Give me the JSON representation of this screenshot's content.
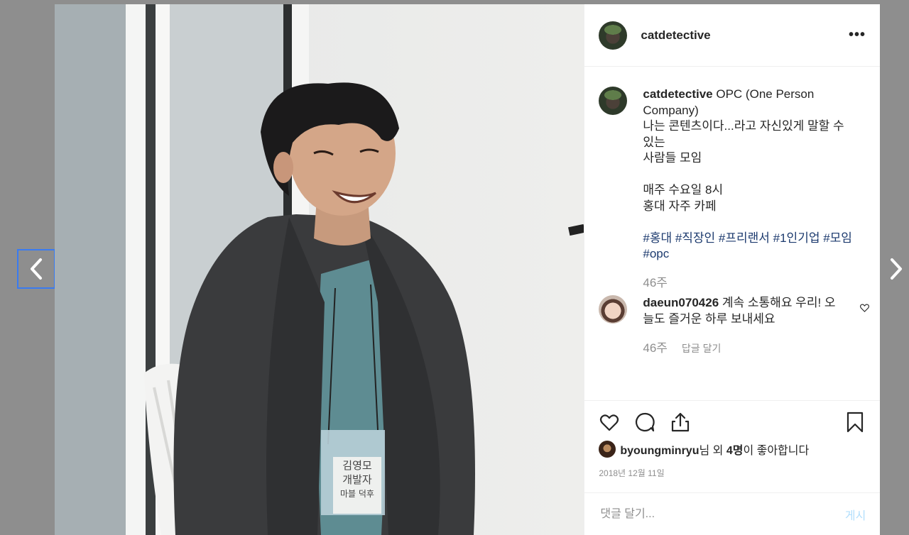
{
  "post": {
    "username": "catdetective",
    "more_icon": "more-horizontal-icon",
    "caption_lines": [
      "OPC (One Person",
      "Company)",
      "나는 콘텐츠이다...라고 자신있게 말할 수 있는",
      "사람들 모임",
      "",
      "매주 수요일 8시",
      "홍대 자주 카페",
      ""
    ],
    "hashtags_line1": "#홍대 #직장인 #프리랜서 #1인기업 #모임",
    "hashtags_line2": "#opc",
    "caption_time": "46주",
    "photo_nametag": [
      "김영모",
      "개발자",
      "마블 덕후"
    ]
  },
  "comments": [
    {
      "username": "daeun070426",
      "text_line1": "계속 소통해요 우리! 오",
      "text_line2": "늘도 즐거운 하루 보내세요",
      "time": "46주",
      "reply_label": "답글 달기"
    }
  ],
  "likes": {
    "user": "byoungminryu",
    "suffix_nim": "님 외 ",
    "count": "4명",
    "suffix_end": "이 좋아합니다"
  },
  "date": "2018년 12월 11일",
  "comment_input": {
    "placeholder": "댓글 달기...",
    "value": ""
  },
  "post_button": "게시",
  "colors": {
    "hashtag": "#1c3a6e",
    "post_button": "#b2dffc",
    "focus_outline": "#3a7bf0"
  }
}
